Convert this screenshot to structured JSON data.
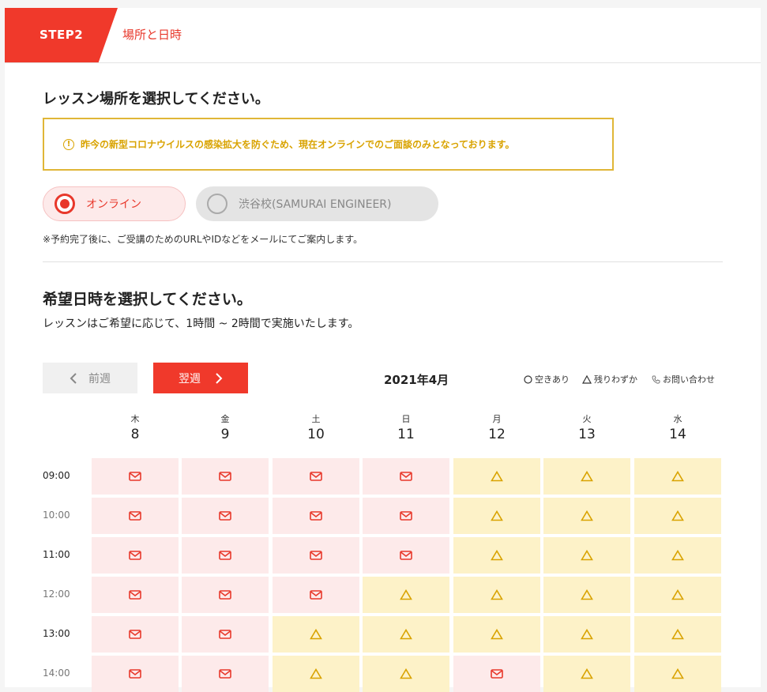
{
  "step": {
    "badge": "STEP2",
    "title": "場所と日時"
  },
  "location": {
    "heading": "レッスン場所を選択してください。",
    "notice": "昨今の新型コロナウイルスの感染拡大を防ぐため、現在オンラインでのご面談のみとなっております。",
    "options": [
      {
        "label": "オンライン",
        "selected": true
      },
      {
        "label": "渋谷校(SAMURAI ENGINEER)",
        "selected": false
      }
    ],
    "note": "※予約完了後に、ご受講のためのURLやIDなどをメールにてご案内します。"
  },
  "schedule": {
    "heading": "希望日時を選択してください。",
    "subtext": "レッスンはご希望に応じて、1時間 ~ 2時間で実施いたします。",
    "prev_label": "前週",
    "next_label": "翌週",
    "month": "2021年4月",
    "legend": {
      "available": "空きあり",
      "few": "残りわずか",
      "contact": "お問い合わせ"
    },
    "days": [
      {
        "dow": "木",
        "date": "8"
      },
      {
        "dow": "金",
        "date": "9"
      },
      {
        "dow": "土",
        "date": "10"
      },
      {
        "dow": "日",
        "date": "11"
      },
      {
        "dow": "月",
        "date": "12"
      },
      {
        "dow": "火",
        "date": "13"
      },
      {
        "dow": "水",
        "date": "14"
      }
    ],
    "rows": [
      {
        "time": "09:00",
        "slots": [
          "mail",
          "mail",
          "mail",
          "mail",
          "few",
          "few",
          "few"
        ]
      },
      {
        "time": "10:00",
        "slots": [
          "mail",
          "mail",
          "mail",
          "mail",
          "few",
          "few",
          "few"
        ]
      },
      {
        "time": "11:00",
        "slots": [
          "mail",
          "mail",
          "mail",
          "mail",
          "few",
          "few",
          "few"
        ]
      },
      {
        "time": "12:00",
        "slots": [
          "mail",
          "mail",
          "mail",
          "few",
          "few",
          "few",
          "few"
        ]
      },
      {
        "time": "13:00",
        "slots": [
          "mail",
          "mail",
          "few",
          "few",
          "few",
          "few",
          "few"
        ]
      },
      {
        "time": "14:00",
        "slots": [
          "mail",
          "mail",
          "few",
          "few",
          "mail",
          "few",
          "few"
        ]
      }
    ],
    "colors": {
      "accent": "#f0392b",
      "mail_bg": "#fdeaea",
      "few_bg": "#fdf2c8",
      "few_icon": "#d9a300"
    }
  }
}
